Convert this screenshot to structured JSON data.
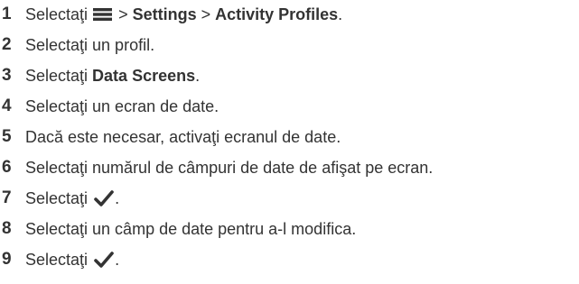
{
  "steps": [
    {
      "number": "1",
      "text_before": "Selectaţi",
      "icon": "menu-icon",
      "text_mid": " > ",
      "bold_1": "Settings",
      "text_mid_2": " > ",
      "bold_2": "Activity Profiles",
      "text_after": "."
    },
    {
      "number": "2",
      "text": "Selectaţi un profil."
    },
    {
      "number": "3",
      "text_before": "Selectaţi ",
      "bold": "Data Screens",
      "text_after": "."
    },
    {
      "number": "4",
      "text": "Selectaţi un ecran de date."
    },
    {
      "number": "5",
      "text": "Dacă este necesar, activaţi ecranul de date."
    },
    {
      "number": "6",
      "text": "Selectaţi numărul de câmpuri de date de afişat pe ecran."
    },
    {
      "number": "7",
      "text_before": "Selectaţi",
      "icon": "checkmark-icon",
      "text_after": "."
    },
    {
      "number": "8",
      "text": "Selectaţi un câmp de date pentru a-l modifica."
    },
    {
      "number": "9",
      "text_before": "Selectaţi",
      "icon": "checkmark-icon",
      "text_after": "."
    }
  ]
}
